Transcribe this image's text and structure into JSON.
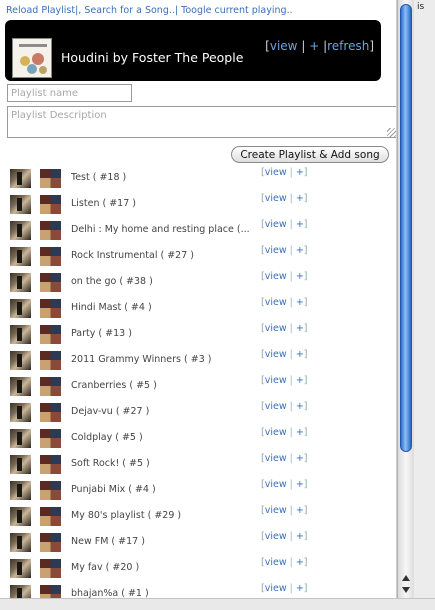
{
  "toplinks": {
    "reload": "Reload Playlist",
    "sep1": "|,",
    "search": "Search for a Song..",
    "sep2": "|",
    "toggle": "Toogle current playing.."
  },
  "edge_label": "is",
  "now_playing": {
    "title": "Houdini by Foster The People",
    "open_bracket": "[",
    "view": "view",
    "sep1": "|",
    "add": "+",
    "sep2": "|",
    "refresh": "refresh",
    "close_bracket": "]"
  },
  "form": {
    "name_placeholder": "Playlist name",
    "desc_placeholder": "Playlist Description",
    "create_button": "Create Playlist & Add song"
  },
  "row_links": {
    "open": "[",
    "view": "view",
    "sep": "|",
    "add": "+",
    "close": "]"
  },
  "playlists": [
    {
      "label": "Test ( #18 )"
    },
    {
      "label": "Listen ( #17 )"
    },
    {
      "label": "Delhi : My home and resting place (..."
    },
    {
      "label": "Rock Instrumental ( #27 )"
    },
    {
      "label": "on the go ( #38 )"
    },
    {
      "label": "Hindi Mast ( #4 )"
    },
    {
      "label": "Party ( #13 )"
    },
    {
      "label": "2011 Grammy Winners ( #3 )"
    },
    {
      "label": "Cranberries ( #5 )"
    },
    {
      "label": "Dejav-vu ( #27 )"
    },
    {
      "label": "Coldplay ( #5 )"
    },
    {
      "label": "Soft Rock! ( #5 )"
    },
    {
      "label": "Punjabi Mix ( #4 )"
    },
    {
      "label": "My 80's playlist ( #29 )"
    },
    {
      "label": "New FM ( #17 )"
    },
    {
      "label": "My fav ( #20 )"
    },
    {
      "label": "bhajan%a ( #1 )"
    }
  ]
}
